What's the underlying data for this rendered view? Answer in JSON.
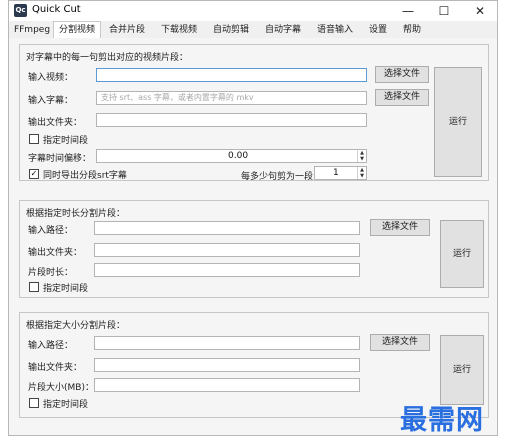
{
  "window": {
    "icon_text": "Qc",
    "title": "Quick Cut",
    "minimize": "—",
    "maximize": "☐",
    "close": "✕"
  },
  "tabs": [
    "FFmpeg",
    "分割视频",
    "合并片段",
    "下载视频",
    "自动剪辑",
    "自动字幕",
    "语音输入",
    "设置",
    "帮助"
  ],
  "active_tab": "分割视频",
  "section1": {
    "title": "对字幕中的每一句剪出对应的视频片段：",
    "input_video_label": "输入视频：",
    "input_video_value": "",
    "input_sub_label": "输入字幕：",
    "input_sub_placeholder": "支持 srt、ass 字幕，或者内置字幕的 mkv",
    "output_label": "输出文件夹：",
    "specify_time_label": "指定时间段",
    "offset_label": "字幕时间偏移：",
    "offset_value": "0.00",
    "export_label": "同时导出分段srt字幕",
    "per_label": "每多少句剪为一段：",
    "per_value": "1",
    "select_file_1": "选择文件",
    "select_file_2": "选择文件",
    "run": "运行"
  },
  "section2": {
    "title": "根据指定时长分割片段：",
    "input_label": "输入路径：",
    "output_label": "输出文件夹：",
    "length_label": "片段时长：",
    "specify_time_label": "指定时间段",
    "select_file": "选择文件",
    "run": "运行"
  },
  "section3": {
    "title": "根据指定大小分割片段：",
    "input_label": "输入路径：",
    "output_label": "输出文件夹：",
    "size_label": "片段大小(MB)：",
    "specify_time_label": "指定时间段",
    "select_file": "选择文件",
    "run": "运行"
  },
  "watermark": "最需网",
  "colors": {
    "focus_border": "#5b9bd5",
    "watermark": "#2a6fe0"
  },
  "icons": [
    "app-icon",
    "minimize-icon",
    "maximize-icon",
    "close-icon",
    "checkbox",
    "spin-arrows"
  ]
}
